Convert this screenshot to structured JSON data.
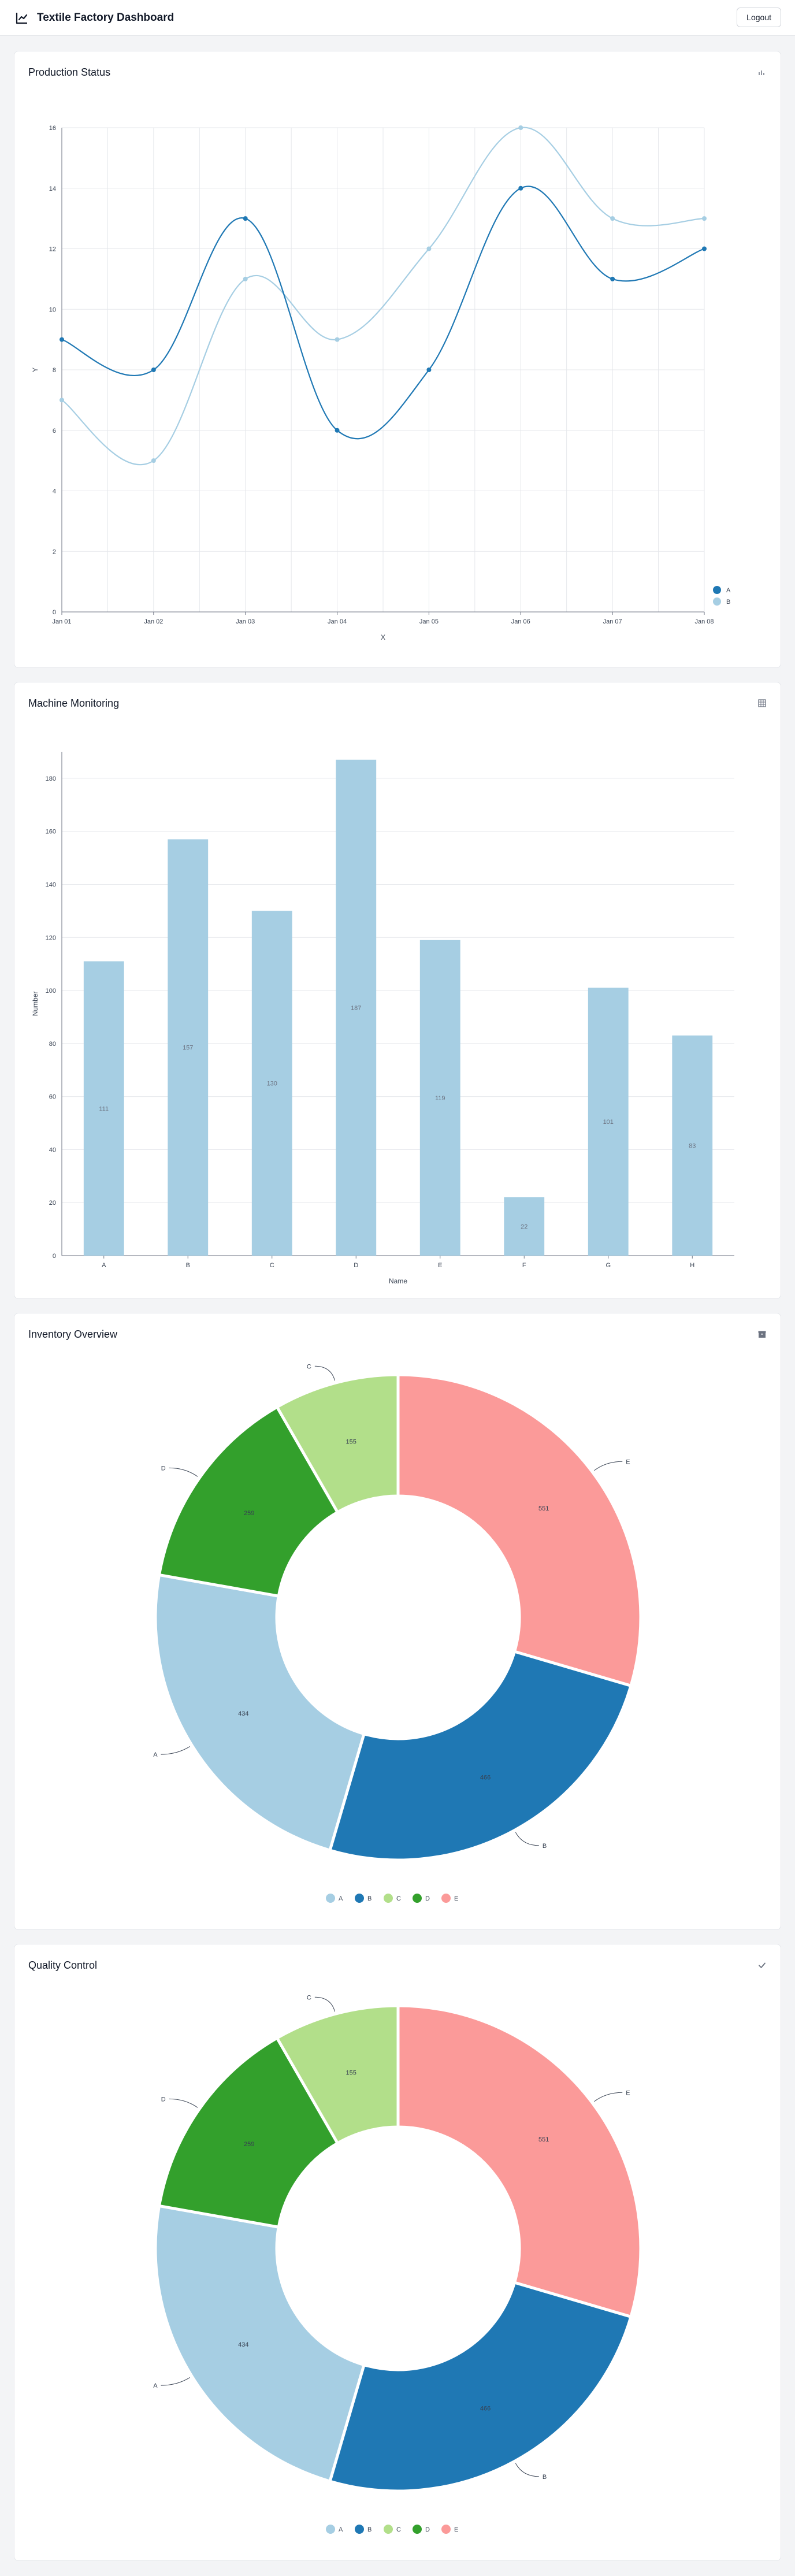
{
  "header": {
    "title": "Textile Factory Dashboard",
    "logout_label": "Logout",
    "icon": "chart-app-icon"
  },
  "cards": [
    {
      "title": "Production Status",
      "icon": "line-chart-icon"
    },
    {
      "title": "Machine Monitoring",
      "icon": "grid-icon"
    },
    {
      "title": "Inventory Overview",
      "icon": "box-icon"
    },
    {
      "title": "Quality Control",
      "icon": "check-icon"
    }
  ],
  "colors": {
    "seriesA": "#1f78b4",
    "seriesB": "#a6cee3",
    "bar": "#a6cee3",
    "pie": [
      "#a6cee3",
      "#1f78b4",
      "#b2df8a",
      "#33a02c",
      "#fb9a99"
    ]
  },
  "chart_data": [
    {
      "type": "line",
      "x": [
        "Jan 01",
        "Jan 02",
        "Jan 03",
        "Jan 04",
        "Jan 05",
        "Jan 06",
        "Jan 07",
        "Jan 08"
      ],
      "series": [
        {
          "name": "A",
          "values": [
            9,
            8,
            13,
            6,
            8,
            14,
            11,
            12
          ]
        },
        {
          "name": "B",
          "values": [
            7,
            5,
            11,
            9,
            12,
            16,
            13,
            13
          ]
        }
      ],
      "xlabel": "X",
      "ylabel": "Y",
      "ylim": [
        0,
        16
      ],
      "yticks": [
        0,
        2,
        4,
        6,
        8,
        10,
        12,
        14,
        16
      ],
      "grid": true,
      "legend": "bottom-right"
    },
    {
      "type": "bar",
      "categories": [
        "A",
        "B",
        "C",
        "D",
        "E",
        "F",
        "G",
        "H"
      ],
      "values": [
        111,
        157,
        130,
        187,
        119,
        22,
        101,
        83
      ],
      "xlabel": "Name",
      "ylabel": "Number",
      "ylim": [
        0,
        190
      ],
      "yticks": [
        0,
        20,
        40,
        60,
        80,
        100,
        120,
        140,
        160,
        180
      ],
      "grid": true
    },
    {
      "type": "pie",
      "labels": [
        "A",
        "B",
        "C",
        "D",
        "E"
      ],
      "values": [
        434,
        466,
        155,
        259,
        551
      ],
      "donut": true,
      "legend": "bottom"
    },
    {
      "type": "pie",
      "labels": [
        "A",
        "B",
        "C",
        "D",
        "E"
      ],
      "values": [
        434,
        466,
        155,
        259,
        551
      ],
      "donut": true,
      "legend": "bottom"
    }
  ]
}
